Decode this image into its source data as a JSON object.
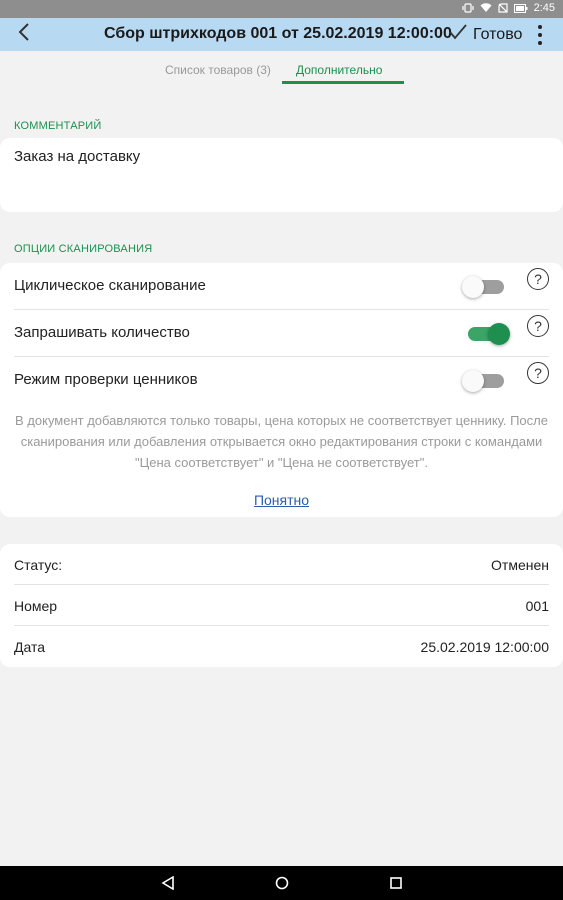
{
  "status_bar": {
    "time": "2:45",
    "icons": [
      "vibrate-icon",
      "wifi-icon",
      "no-sim-icon",
      "battery-icon"
    ]
  },
  "app_bar": {
    "title": "Сбор штрихкодов 001 от 25.02.2019 12:00:00",
    "done_label": "Готово",
    "back_icon": "chevron-left-icon",
    "done_icon": "checkmark-icon",
    "menu_icon": "more-vert-icon",
    "background": "#b8d9f2"
  },
  "tabs": [
    {
      "label": "Список товаров (3)",
      "active": false
    },
    {
      "label": "Дополнительно",
      "active": true
    }
  ],
  "comment_section": {
    "header": "КОММЕНТАРИЙ",
    "value": "Заказ на доставку"
  },
  "scan_options": {
    "header": "ОПЦИИ СКАНИРОВАНИЯ",
    "options": [
      {
        "label": "Циклическое сканирование",
        "enabled": false
      },
      {
        "label": "Запрашивать количество",
        "enabled": true
      },
      {
        "label": "Режим проверки ценников",
        "enabled": false
      }
    ],
    "help_glyph": "?",
    "hint": "В документ добавляются только товары, цена которых не соответствует ценнику. После сканирования или добавления открывается окно редактирования строки с командами \"Цена соответствует\" и \"Цена не соответствует\".",
    "understood_link": "Понятно"
  },
  "info": {
    "rows": [
      {
        "label": "Статус:",
        "value": "Отменен"
      },
      {
        "label": "Номер",
        "value": "001"
      },
      {
        "label": "Дата",
        "value": "25.02.2019 12:00:00"
      }
    ]
  },
  "nav_bar": {
    "buttons": [
      "nav-back-icon",
      "nav-home-icon",
      "nav-recents-icon"
    ]
  },
  "colors": {
    "accent_green": "#1e8f4e",
    "link_blue": "#2a5db0",
    "page_background": "#f2f2f2"
  }
}
